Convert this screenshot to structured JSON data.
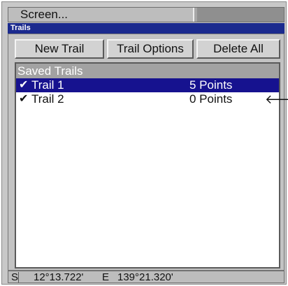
{
  "menubar": {
    "screen_label": "Screen..."
  },
  "window": {
    "title": "Trails"
  },
  "toolbar": {
    "new_trail_label": "New Trail",
    "trail_options_label": "Trail Options",
    "delete_all_label": "Delete All"
  },
  "saved_trails": {
    "header": "Saved Trails",
    "items": [
      {
        "check": "✔",
        "name": "Trail 1",
        "points": "5 Points",
        "selected": true
      },
      {
        "check": "✔",
        "name": "Trail 2",
        "points": "0 Points",
        "selected": false,
        "marker": "🡐"
      }
    ]
  },
  "status": {
    "lat_dir": "S",
    "lat": "12°13.722'",
    "lon_dir": "E",
    "lon": "139°21.320'"
  },
  "colors": {
    "title_bar": "#1b2a8e",
    "selected_row": "#16128f",
    "panel_header": "#a2a2a2"
  }
}
